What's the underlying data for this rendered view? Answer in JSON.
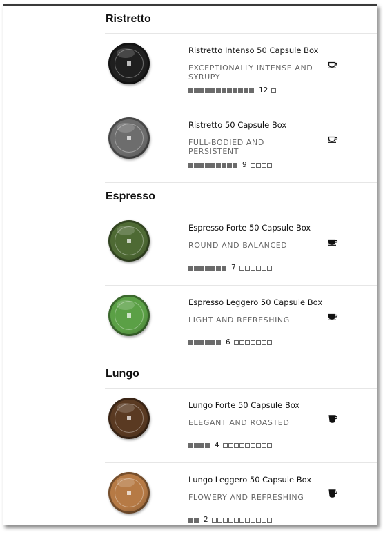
{
  "sections": [
    {
      "title": "Ristretto",
      "products": [
        {
          "name": "Ristretto Intenso 50 Capsule Box",
          "description": "EXCEPTIONALLY INTENSE AND SYRUPY",
          "intensity": "12",
          "intensity_value": 12,
          "scale_max": 13,
          "capsule_color": "#1f1f1f",
          "cup_icon": "espresso-cup-icon"
        },
        {
          "name": "Ristretto 50 Capsule Box",
          "description": "FULL-BODIED AND PERSISTENT",
          "intensity": "9",
          "intensity_value": 9,
          "scale_max": 13,
          "capsule_color": "#6d6d6d",
          "cup_icon": "espresso-cup-icon"
        }
      ]
    },
    {
      "title": "Espresso",
      "products": [
        {
          "name": "Espresso Forte 50 Capsule Box",
          "description": "ROUND AND BALANCED",
          "intensity": "7",
          "intensity_value": 7,
          "scale_max": 13,
          "capsule_color": "#4e6a34",
          "cup_icon": "espresso-cup-filled-icon"
        },
        {
          "name": "Espresso Leggero 50 Capsule Box",
          "description": "LIGHT AND REFRESHING",
          "intensity": "6",
          "intensity_value": 6,
          "scale_max": 13,
          "capsule_color": "#5ba046",
          "cup_icon": "espresso-cup-filled-icon"
        }
      ]
    },
    {
      "title": "Lungo",
      "products": [
        {
          "name": "Lungo Forte 50 Capsule Box",
          "description": "ELEGANT AND ROASTED",
          "intensity": "4",
          "intensity_value": 4,
          "scale_max": 13,
          "capsule_color": "#5a3a22",
          "cup_icon": "lungo-cup-filled-icon"
        },
        {
          "name": "Lungo Leggero 50 Capsule Box",
          "description": "FLOWERY AND REFRESHING",
          "intensity": "2",
          "intensity_value": 2,
          "scale_max": 13,
          "capsule_color": "#b67a45",
          "cup_icon": "lungo-cup-filled-icon"
        }
      ]
    }
  ]
}
